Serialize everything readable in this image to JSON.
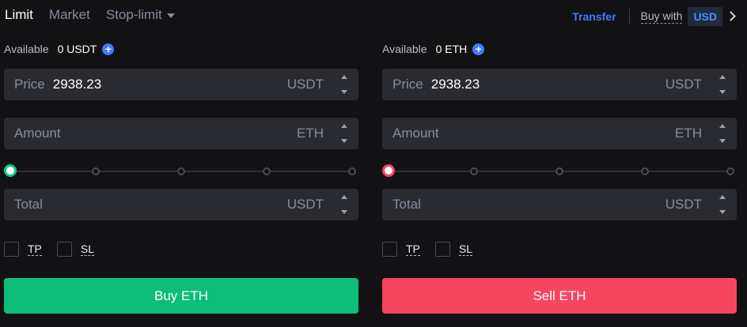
{
  "tabs": [
    {
      "label": "Limit",
      "active": true
    },
    {
      "label": "Market",
      "active": false
    },
    {
      "label": "Stop-limit",
      "active": false,
      "has_dropdown": true
    }
  ],
  "header": {
    "transfer_label": "Transfer",
    "buy_with_label": "Buy with",
    "currency": "USD"
  },
  "buy": {
    "available_label": "Available",
    "available_value": "0 USDT",
    "price": {
      "label": "Price",
      "value": "2938.23",
      "unit": "USDT"
    },
    "amount": {
      "label": "Amount",
      "value": "",
      "unit": "ETH"
    },
    "total": {
      "label": "Total",
      "value": "",
      "unit": "USDT"
    },
    "slider_percent": 0,
    "tp_label": "TP",
    "sl_label": "SL",
    "button_label": "Buy ETH"
  },
  "sell": {
    "available_label": "Available",
    "available_value": "0 ETH",
    "price": {
      "label": "Price",
      "value": "2938.23",
      "unit": "USDT"
    },
    "amount": {
      "label": "Amount",
      "value": "",
      "unit": "ETH"
    },
    "total": {
      "label": "Total",
      "value": "",
      "unit": "USDT"
    },
    "slider_percent": 0,
    "tp_label": "TP",
    "sl_label": "SL",
    "button_label": "Sell ETH"
  },
  "colors": {
    "buy": "#0ebd79",
    "sell": "#f6465d",
    "accent": "#3d7bff",
    "background": "#121214",
    "input_bg": "#2a2b31"
  },
  "icons": {
    "add": "plus-circle-icon",
    "stepper_up": "caret-up-icon",
    "stepper_down": "caret-down-icon",
    "dropdown": "caret-down-icon",
    "next": "chevron-right-icon"
  }
}
